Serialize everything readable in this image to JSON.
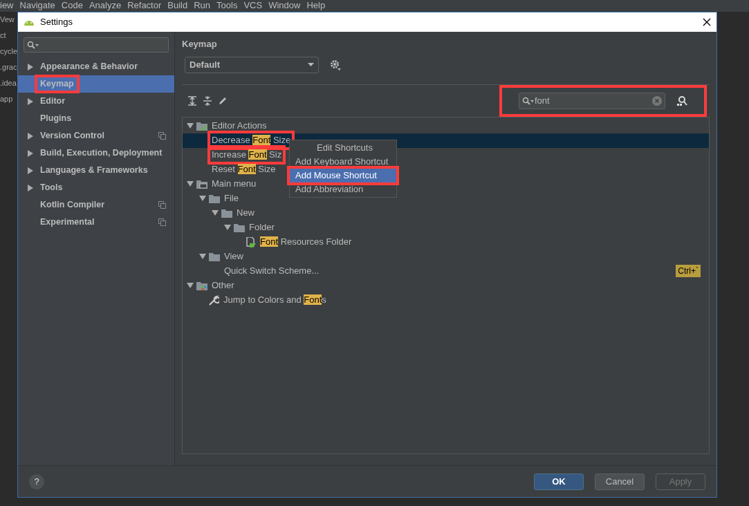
{
  "ide_menu": [
    "iew",
    "Navigate",
    "Code",
    "Analyze",
    "Refactor",
    "Build",
    "Run",
    "Tools",
    "VCS",
    "Window",
    "Help"
  ],
  "ide_fragments": [
    "Vew",
    "ct",
    "cycle",
    ".grac",
    ".idea",
    "app"
  ],
  "window": {
    "title": "Settings"
  },
  "sidebar": {
    "items": [
      {
        "label": "Appearance & Behavior",
        "expandable": true,
        "selected": false,
        "project_level": false,
        "annotated": false
      },
      {
        "label": "Keymap",
        "expandable": false,
        "selected": true,
        "project_level": false,
        "annotated": true
      },
      {
        "label": "Editor",
        "expandable": true,
        "selected": false,
        "project_level": false,
        "annotated": false
      },
      {
        "label": "Plugins",
        "expandable": false,
        "selected": false,
        "project_level": false,
        "annotated": false
      },
      {
        "label": "Version Control",
        "expandable": true,
        "selected": false,
        "project_level": true,
        "annotated": false
      },
      {
        "label": "Build, Execution, Deployment",
        "expandable": true,
        "selected": false,
        "project_level": false,
        "annotated": false
      },
      {
        "label": "Languages & Frameworks",
        "expandable": true,
        "selected": false,
        "project_level": false,
        "annotated": false
      },
      {
        "label": "Tools",
        "expandable": true,
        "selected": false,
        "project_level": false,
        "annotated": false
      },
      {
        "label": "Kotlin Compiler",
        "expandable": false,
        "selected": false,
        "project_level": true,
        "annotated": false
      },
      {
        "label": "Experimental",
        "expandable": false,
        "selected": false,
        "project_level": true,
        "annotated": false
      }
    ]
  },
  "keymap": {
    "title": "Keymap",
    "scheme": "Default",
    "search": {
      "value": "font",
      "annotated": true
    },
    "tree": [
      {
        "kind": "actions",
        "expanded": true,
        "parts": [
          {
            "text": "Editor Actions",
            "match": false
          }
        ],
        "children": [
          {
            "kind": "action",
            "selected": true,
            "annotated": true,
            "parts": [
              {
                "text": "Decrease ",
                "match": false
              },
              {
                "text": "Font",
                "match": true
              },
              {
                "text": " Size",
                "match": false
              }
            ]
          },
          {
            "kind": "action",
            "selected": false,
            "annotated": true,
            "parts": [
              {
                "text": "Increase ",
                "match": false
              },
              {
                "text": "Font",
                "match": true
              },
              {
                "text": " Siz",
                "match": false
              }
            ]
          },
          {
            "kind": "action",
            "selected": false,
            "annotated": false,
            "parts": [
              {
                "text": "Reset ",
                "match": false
              },
              {
                "text": "Font",
                "match": true
              },
              {
                "text": " Size",
                "match": false
              }
            ]
          }
        ]
      },
      {
        "kind": "menu",
        "expanded": true,
        "parts": [
          {
            "text": "Main menu",
            "match": false
          }
        ],
        "children": [
          {
            "kind": "folder",
            "expanded": true,
            "parts": [
              {
                "text": "File",
                "match": false
              }
            ],
            "children": [
              {
                "kind": "folder",
                "expanded": true,
                "parts": [
                  {
                    "text": "New",
                    "match": false
                  }
                ],
                "children": [
                  {
                    "kind": "folder",
                    "expanded": true,
                    "parts": [
                      {
                        "text": "Folder",
                        "match": false
                      }
                    ],
                    "children": [
                      {
                        "kind": "file",
                        "selected": false,
                        "annotated": false,
                        "parts": [
                          {
                            "text": "Font",
                            "match": true
                          },
                          {
                            "text": " Resources Folder",
                            "match": false
                          }
                        ]
                      }
                    ]
                  }
                ]
              }
            ]
          },
          {
            "kind": "folder",
            "expanded": true,
            "parts": [
              {
                "text": "View",
                "match": false
              }
            ],
            "children": [
              {
                "kind": "action",
                "selected": false,
                "annotated": false,
                "shortcut": "Ctrl+`",
                "parts": [
                  {
                    "text": "Quick Switch Scheme...",
                    "match": false
                  }
                ]
              }
            ]
          }
        ]
      },
      {
        "kind": "other",
        "expanded": true,
        "parts": [
          {
            "text": "Other",
            "match": false
          }
        ],
        "children": [
          {
            "kind": "tool",
            "selected": false,
            "annotated": false,
            "parts": [
              {
                "text": "Jump to Colors and ",
                "match": false
              },
              {
                "text": "Font",
                "match": true
              },
              {
                "text": "s",
                "match": false
              }
            ]
          }
        ]
      }
    ],
    "context_menu": [
      {
        "label": "Edit Shortcuts",
        "selected": false,
        "annotated": false
      },
      {
        "label": "Add Keyboard Shortcut",
        "selected": false,
        "annotated": false
      },
      {
        "label": "Add Mouse Shortcut",
        "selected": true,
        "annotated": true
      },
      {
        "label": "Add Abbreviation",
        "selected": false,
        "annotated": false
      }
    ]
  },
  "help": "?",
  "buttons": [
    {
      "label": "OK",
      "kind": "primary",
      "disabled": false
    },
    {
      "label": "Cancel",
      "kind": "normal",
      "disabled": false
    },
    {
      "label": "Apply",
      "kind": "normal",
      "disabled": true
    }
  ]
}
